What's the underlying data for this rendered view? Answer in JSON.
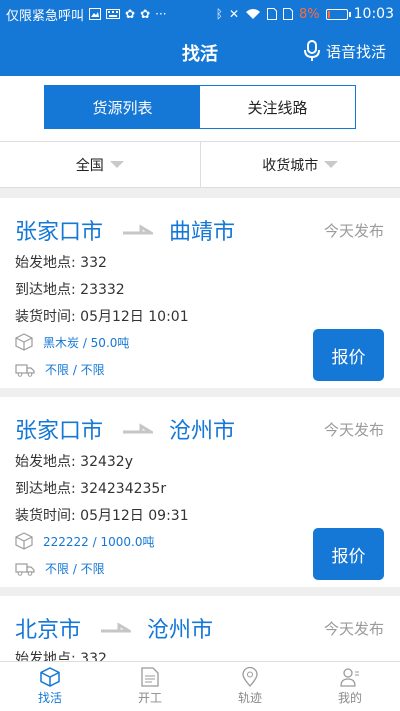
{
  "status": {
    "carrier": "仅限紧急呼叫",
    "battery_pct": "8%",
    "time": "10:03"
  },
  "header": {
    "title": "找活",
    "voice_label": "语音找活"
  },
  "tabs": [
    {
      "label": "货源列表",
      "active": true
    },
    {
      "label": "关注线路",
      "active": false
    }
  ],
  "filters": [
    {
      "label": "全国"
    },
    {
      "label": "收货城市"
    }
  ],
  "labels": {
    "origin": "始发地点: ",
    "destination": "到达地点: ",
    "loading_time": "装货时间: "
  },
  "cards": [
    {
      "from": "张家口市",
      "to": "曲靖市",
      "published": "今天发布",
      "origin_value": "332",
      "destination_value": "23332",
      "loading_time_value": "05月12日 10:01",
      "cargo": "黑木炭 / 50.0吨",
      "vehicle": "不限 / 不限",
      "quote_label": "报价"
    },
    {
      "from": "张家口市",
      "to": "沧州市",
      "published": "今天发布",
      "origin_value": "32432y",
      "destination_value": "324234235r",
      "loading_time_value": "05月12日 09:31",
      "cargo": "222222 / 1000.0吨",
      "vehicle": "不限 / 不限",
      "quote_label": "报价"
    },
    {
      "from": "北京市",
      "to": "沧州市",
      "published": "今天发布",
      "origin_value": "332"
    }
  ],
  "nav": [
    {
      "label": "找活",
      "icon": "box-icon",
      "active": true
    },
    {
      "label": "开工",
      "icon": "document-icon",
      "active": false
    },
    {
      "label": "轨迹",
      "icon": "location-pin-icon",
      "active": false
    },
    {
      "label": "我的",
      "icon": "user-icon",
      "active": false
    }
  ],
  "colors": {
    "accent": "#1577d6",
    "published": "#9b9b9b",
    "battery_low": "#ff6a3d"
  }
}
